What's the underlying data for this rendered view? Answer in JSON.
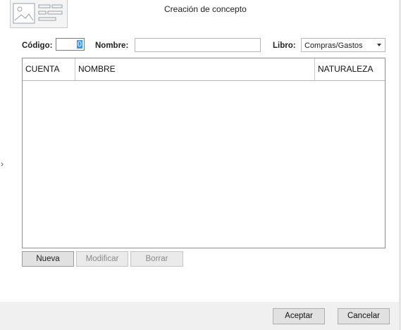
{
  "window": {
    "title": "Creación de concepto"
  },
  "form": {
    "codigo_label": "Código:",
    "codigo_value": "0",
    "nombre_label": "Nombre:",
    "nombre_value": "",
    "libro_label": "Libro:",
    "libro_value": "Compras/Gastos"
  },
  "grid": {
    "columns": [
      "CUENTA",
      "NOMBRE",
      "NATURALEZA"
    ],
    "rows": []
  },
  "actions": {
    "nueva": "Nueva",
    "modificar": "Modificar",
    "borrar": "Borrar"
  },
  "footer": {
    "aceptar": "Aceptar",
    "cancelar": "Cancelar"
  },
  "icons": {
    "header": "document-form-icon",
    "left": "chevron-right-icon",
    "dropdown": "chevron-down-icon"
  },
  "colors": {
    "selection": "#3399ff",
    "footer_bg": "#f0f0f0"
  }
}
